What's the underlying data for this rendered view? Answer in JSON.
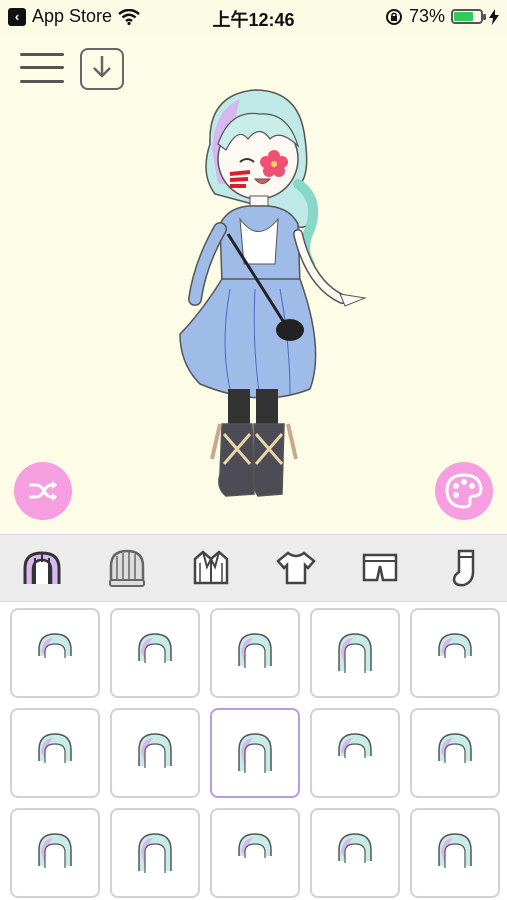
{
  "status_bar": {
    "back_app": "App Store",
    "time": "上午12:46",
    "battery_percent": "73%",
    "battery_level": 0.73
  },
  "canvas": {
    "colors": {
      "background": "#fdfce6",
      "accent": "#f59ee0"
    },
    "icons": {
      "menu": "hamburger-icon",
      "save": "download-icon",
      "shuffle": "shuffle-icon",
      "palette": "palette-icon"
    }
  },
  "categories": [
    {
      "icon": "hair-icon",
      "selected": true
    },
    {
      "icon": "hat-icon",
      "selected": false
    },
    {
      "icon": "jacket-icon",
      "selected": false
    },
    {
      "icon": "shirt-icon",
      "selected": false
    },
    {
      "icon": "shorts-icon",
      "selected": false
    },
    {
      "icon": "sock-icon",
      "selected": false
    }
  ],
  "hair_items": {
    "selected_index": 7,
    "count": 15,
    "item_icon": "hairstyle-icon"
  }
}
